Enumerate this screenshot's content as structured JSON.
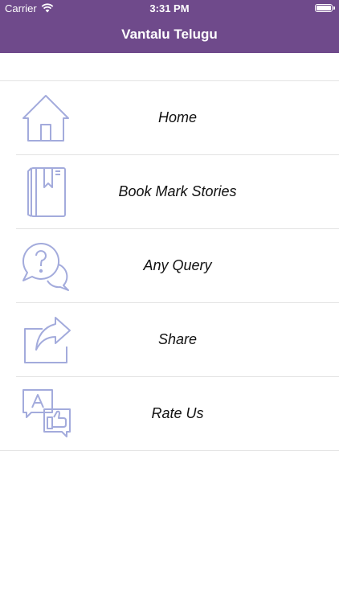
{
  "status_bar": {
    "carrier": "Carrier",
    "time": "3:31 PM",
    "icons": [
      "wifi-icon",
      "battery-icon"
    ]
  },
  "header": {
    "title": "Vantalu Telugu",
    "background": "#6f4a8b"
  },
  "menu": {
    "icon_color": "#a3abdc",
    "items": [
      {
        "label": "Home",
        "icon": "home-icon"
      },
      {
        "label": "Book Mark Stories",
        "icon": "bookmark-book-icon"
      },
      {
        "label": "Any Query",
        "icon": "question-chat-icon"
      },
      {
        "label": "Share",
        "icon": "share-icon"
      },
      {
        "label": "Rate Us",
        "icon": "rate-thumbs-up-icon"
      }
    ]
  }
}
